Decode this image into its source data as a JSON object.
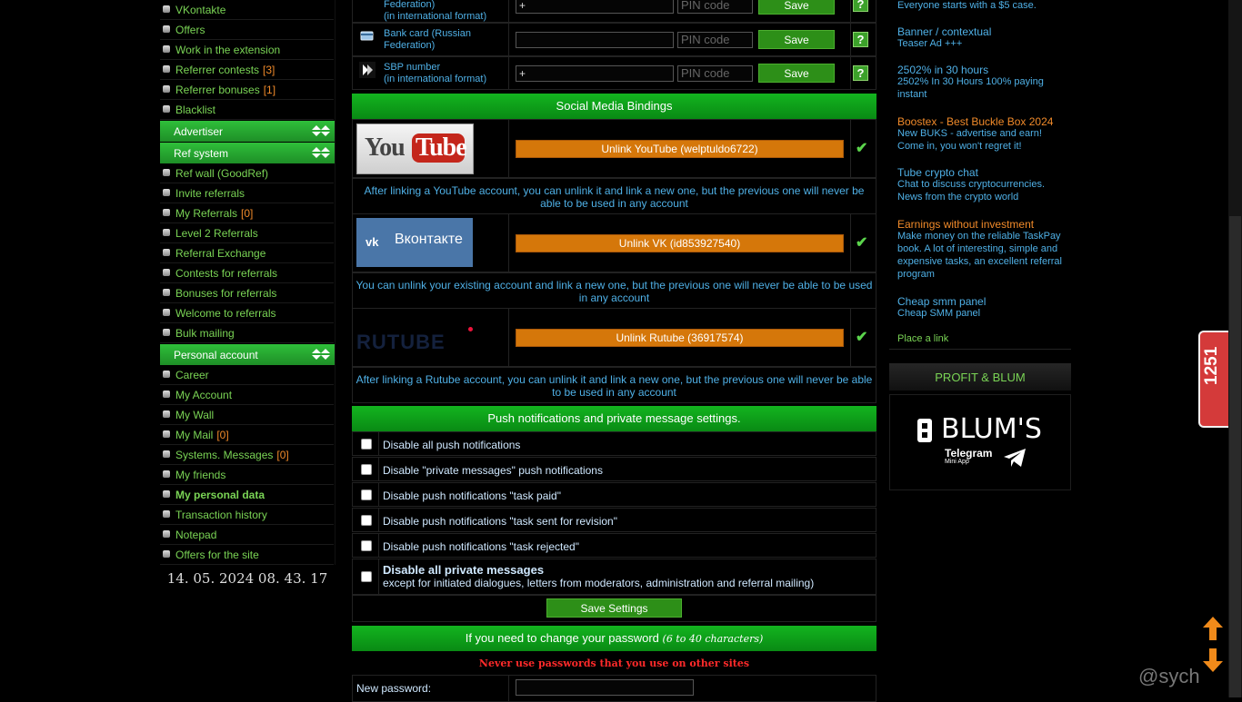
{
  "sidebar": {
    "top_items": [
      {
        "label": "VKontakte",
        "count": ""
      },
      {
        "label": "Offers",
        "count": ""
      },
      {
        "label": "Work in the extension",
        "count": ""
      },
      {
        "label": "Referrer contests",
        "count": "[3]"
      },
      {
        "label": "Referrer bonuses",
        "count": "[1]"
      },
      {
        "label": "Blacklist",
        "count": ""
      }
    ],
    "advertiser_header": "Advertiser",
    "ref_header": "Ref system",
    "ref_items": [
      {
        "label": "Ref wall (GoodRef)",
        "count": ""
      },
      {
        "label": "Invite referrals",
        "count": ""
      },
      {
        "label": "My Referrals",
        "count": "[0]"
      },
      {
        "label": "Level 2 Referrals",
        "count": ""
      },
      {
        "label": "Referral Exchange",
        "count": ""
      },
      {
        "label": "Contests for referrals",
        "count": ""
      },
      {
        "label": "Bonuses for referrals",
        "count": ""
      },
      {
        "label": "Welcome to referrals",
        "count": ""
      },
      {
        "label": "Bulk mailing",
        "count": ""
      }
    ],
    "personal_header": "Personal account",
    "personal_items": [
      {
        "label": "Career",
        "count": ""
      },
      {
        "label": "My Account",
        "count": ""
      },
      {
        "label": "My Wall",
        "count": ""
      },
      {
        "label": "My Mail",
        "count": "[0]"
      },
      {
        "label": "Systems. Messages",
        "count": "[0]"
      },
      {
        "label": "My friends",
        "count": ""
      },
      {
        "label": "My personal data",
        "count": ""
      },
      {
        "label": "Transaction history",
        "count": ""
      },
      {
        "label": "Notepad",
        "count": ""
      },
      {
        "label": "Offers for the site",
        "count": ""
      }
    ],
    "clock": "14. 05. 2024 08. 43. 17"
  },
  "wallets": {
    "row1_label_line1": "Federation)",
    "row1_label_line2": "(in international format)",
    "row1_value": "+",
    "row2_label_line1": "Bank card (Russian",
    "row2_label_line2": "Federation)",
    "row2_value": "",
    "row3_label_line1": "SBP number",
    "row3_label_line2": "(in international format)",
    "row3_value": "+",
    "pin_placeholder": "PIN code",
    "save_label": "Save",
    "help_label": "?"
  },
  "social": {
    "header": "Social Media Bindings",
    "youtube_logo_text": "YouTube",
    "youtube_button": "Unlink YouTube (welptuldo6722)",
    "youtube_note": "After linking a YouTube account, you can unlink it and link a new one, but the previous one will never be able to be used in any account",
    "vk_logo_text": "Вконтакте",
    "vk_button": "Unlink VK (id853927540)",
    "vk_note": "You can unlink your existing account and link a new one, but the previous one will never be able to be used in any account",
    "rutube_logo_text": "RUTUBE",
    "rutube_button": "Unlink Rutube (36917574)",
    "rutube_note": "After linking a Rutube account, you can unlink it and link a new one, but the previous one will never be able to be used in any account",
    "check_symbol": "✔"
  },
  "push": {
    "header": "Push notifications and private message settings.",
    "options": [
      "Disable all push notifications",
      "Disable \"private messages\" push notifications",
      "Disable push notifications \"task paid\"",
      "Disable push notifications \"task sent for revision\"",
      "Disable push notifications \"task rejected\""
    ],
    "pm_title": "Disable all private messages",
    "pm_sub": "except for initiated dialogues, letters from moderators, administration and referral mailing)",
    "save_settings": "Save Settings"
  },
  "password": {
    "header": "If you need to change your password",
    "header_hint": "(6 to 40 characters)",
    "warning": "Never use passwords that you use on other sites",
    "new_password_label": "New password:"
  },
  "ads": [
    {
      "title": "",
      "desc": "Everyone starts with a $5 case.",
      "color": "#4fb0e6"
    },
    {
      "title": "Banner / contextual",
      "desc": "Teaser Ad +++",
      "color": "#4fb0e6"
    },
    {
      "title": "2502% in 30 hours",
      "desc": "2502% In 30 Hours 100% paying instant",
      "color": "#4fb0e6"
    },
    {
      "title": "Boostex - Best Buckle Box 2024",
      "desc": "New BUKS - advertise and earn! Come in, you won't regret it!",
      "color": "#f08a2a"
    },
    {
      "title": "Tube crypto chat",
      "desc": "Chat to discuss cryptocurrencies. News from the crypto world",
      "color": "#4fb0e6"
    },
    {
      "title": "Earnings without investment",
      "desc": "Make money on the reliable TaskPay book. A lot of interesting, simple and expensive tasks, an excellent referral program",
      "color": "#f08a2a"
    },
    {
      "title": "Cheap smm panel",
      "desc": "Cheap SMM panel",
      "color": "#4fb0e6"
    }
  ],
  "place_link": "Place a link",
  "profit_header": "PROFIT & BLUM",
  "blum": {
    "brand": "BLUM'S",
    "sub1": "Telegram",
    "sub2": "Mini App"
  },
  "floating_counter": "1251",
  "watermark": "@sych",
  "colors": {
    "accent_green": "#13b41f",
    "link_green": "#7ad455",
    "link_blue": "#4fb0e6",
    "orange": "#d5770a",
    "warning_red": "#ff2a2a"
  }
}
